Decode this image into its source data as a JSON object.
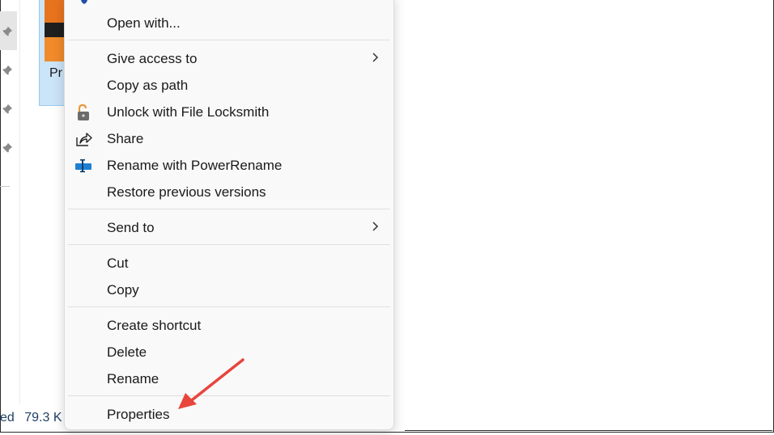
{
  "file": {
    "label": "Pr"
  },
  "status": {
    "left_text": "ed",
    "size_text": "79.3 K"
  },
  "menu": {
    "items": [
      {
        "label": "Open with..."
      },
      {
        "label": "Give access to",
        "submenu": true
      },
      {
        "label": "Copy as path"
      },
      {
        "label": "Unlock with File Locksmith",
        "icon": "lock-icon"
      },
      {
        "label": "Share",
        "icon": "share-icon"
      },
      {
        "label": "Rename with PowerRename",
        "icon": "powerrename-icon"
      },
      {
        "label": "Restore previous versions"
      },
      {
        "label": "Send to",
        "submenu": true
      },
      {
        "label": "Cut"
      },
      {
        "label": "Copy"
      },
      {
        "label": "Create shortcut"
      },
      {
        "label": "Delete"
      },
      {
        "label": "Rename"
      },
      {
        "label": "Properties"
      }
    ]
  },
  "colors": {
    "arrow": "#e8453c",
    "selection": "#cce4f7",
    "status_text": "#1e3f66",
    "lock_orange": "#e8963a",
    "powerrename_blue": "#1e7fd0"
  }
}
